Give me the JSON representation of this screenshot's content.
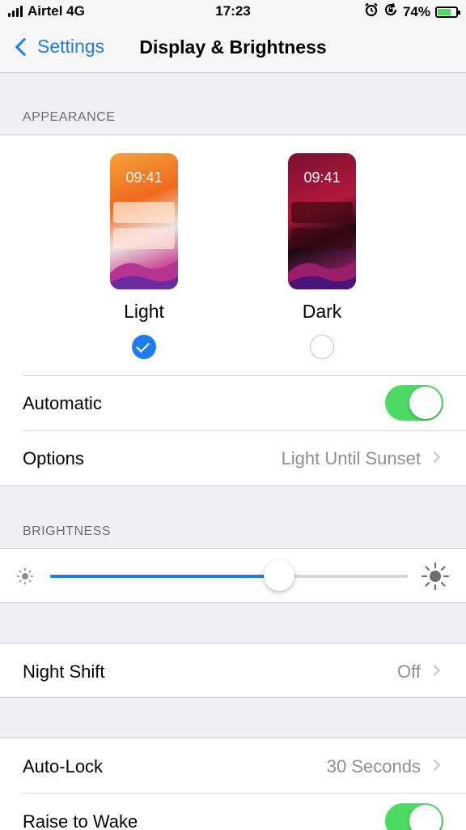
{
  "status_bar": {
    "carrier": "Airtel 4G",
    "time": "17:23",
    "battery_percent": "74%",
    "battery_level": 0.74,
    "icons": [
      "signal-icon",
      "alarm-icon",
      "rotation-lock-icon",
      "battery-icon"
    ]
  },
  "nav": {
    "back_label": "Settings",
    "title": "Display & Brightness"
  },
  "appearance": {
    "header": "APPEARANCE",
    "light": {
      "clock": "09:41",
      "label": "Light",
      "selected": true
    },
    "dark": {
      "clock": "09:41",
      "label": "Dark",
      "selected": false
    },
    "automatic_label": "Automatic",
    "automatic_on": true,
    "options_label": "Options",
    "options_value": "Light Until Sunset"
  },
  "brightness": {
    "header": "BRIGHTNESS",
    "level": 0.64
  },
  "night_shift": {
    "label": "Night Shift",
    "value": "Off"
  },
  "lock": {
    "auto_lock_label": "Auto-Lock",
    "auto_lock_value": "30 Seconds",
    "raise_to_wake_label": "Raise to Wake",
    "raise_to_wake_on": true
  },
  "colors": {
    "accent": "#1e7cf2",
    "toggle_on": "#4cd964",
    "secondary_text": "#8e8e93",
    "background": "#efeff4"
  }
}
